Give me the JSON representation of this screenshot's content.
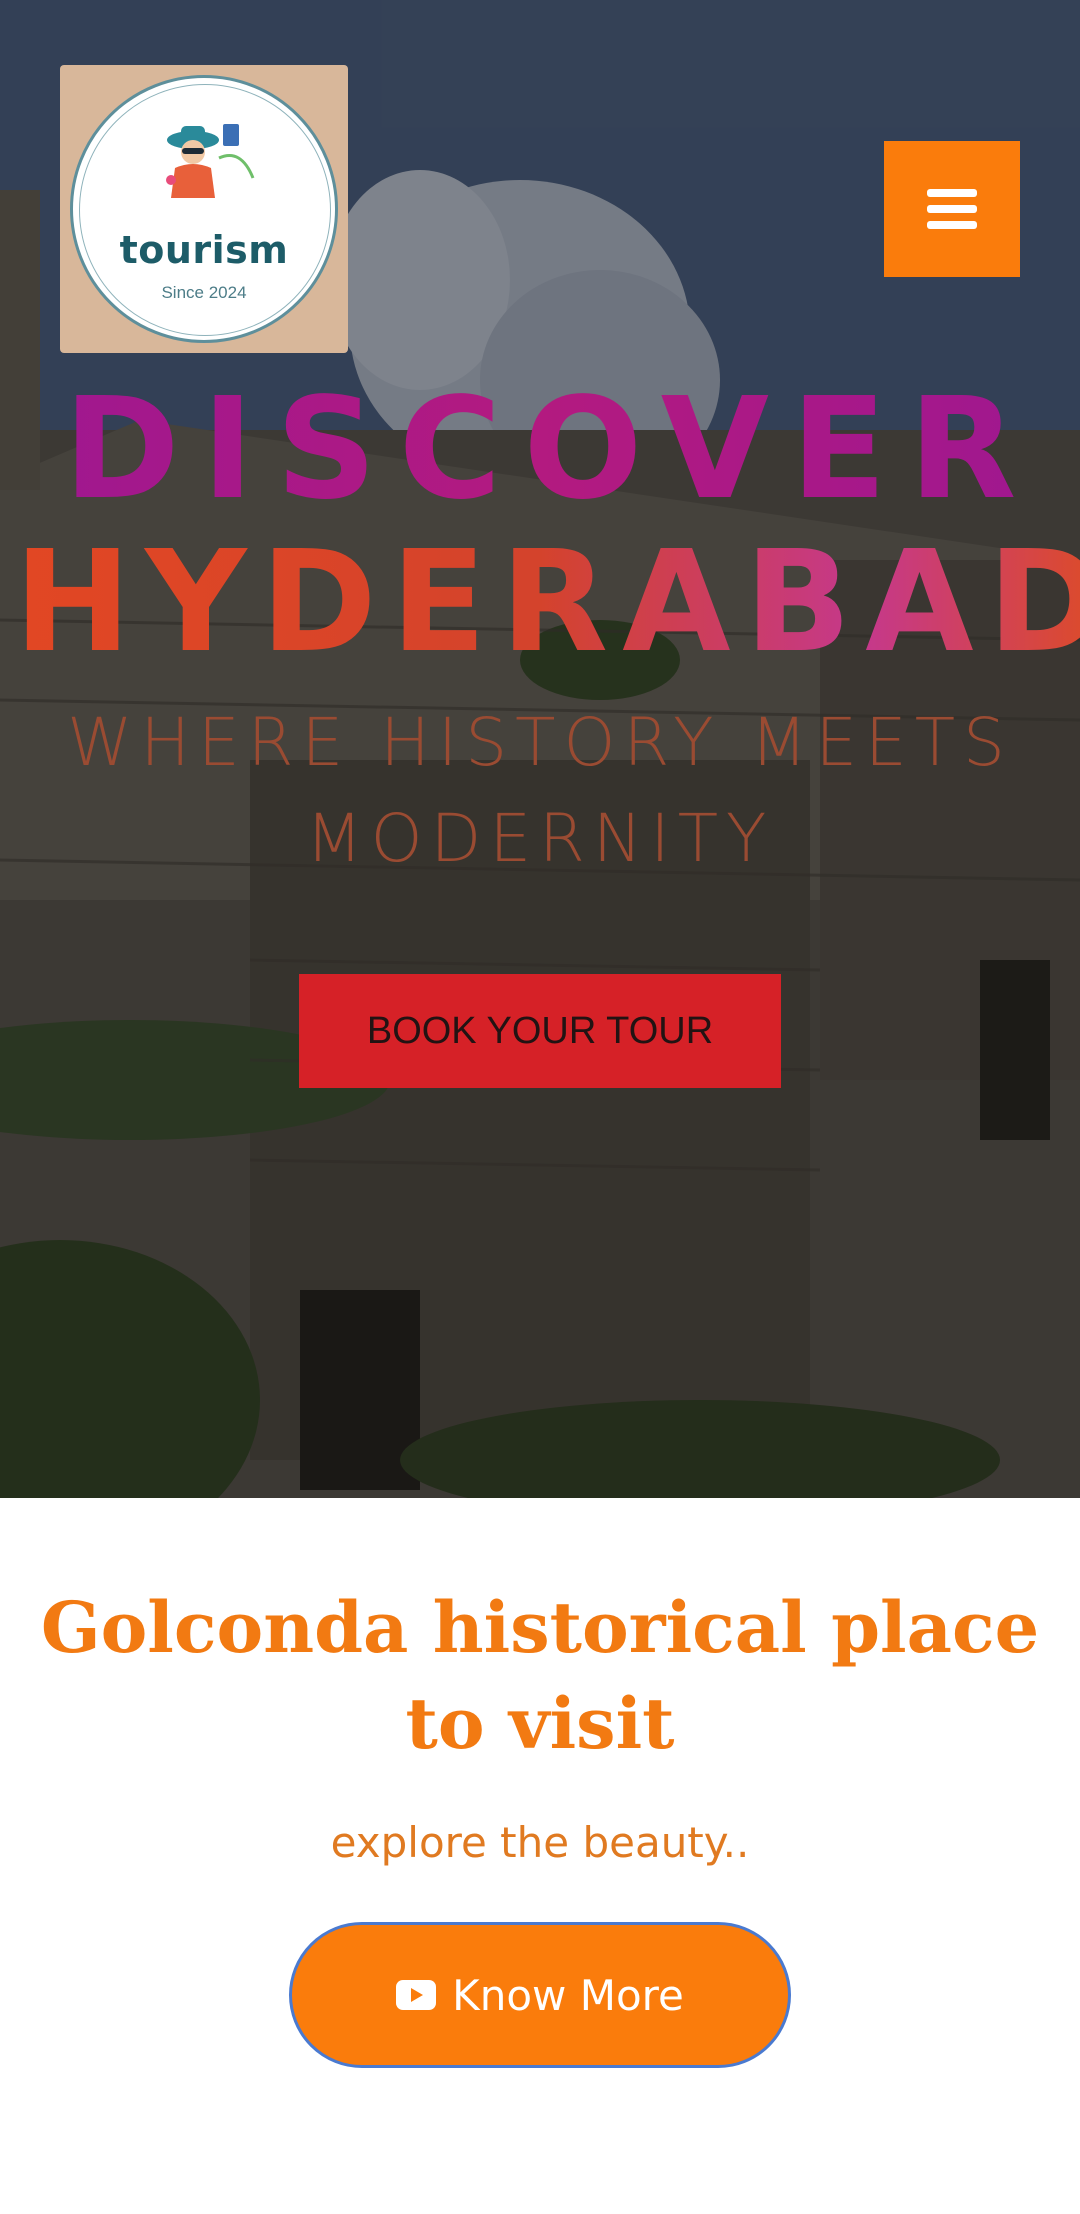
{
  "header": {
    "logo": {
      "word": "tourism",
      "since": "Since 2024"
    },
    "menu_icon": "hamburger-menu-icon"
  },
  "hero": {
    "headline_line1": "DISCOVER",
    "headline_line2": "HYDERABAD",
    "tagline": "WHERE HISTORY MEETS MODERNITY",
    "cta_label": "BOOK YOUR TOUR"
  },
  "feature": {
    "title": "Golconda historical place to visit",
    "subtitle": "explore the beauty..",
    "button_label": "Know More",
    "button_icon": "youtube-icon"
  },
  "colors": {
    "accent_orange": "#fa7c0c",
    "cta_red": "#d62127",
    "headline_purple": "#a0168a",
    "headline_orange": "#e24723"
  }
}
